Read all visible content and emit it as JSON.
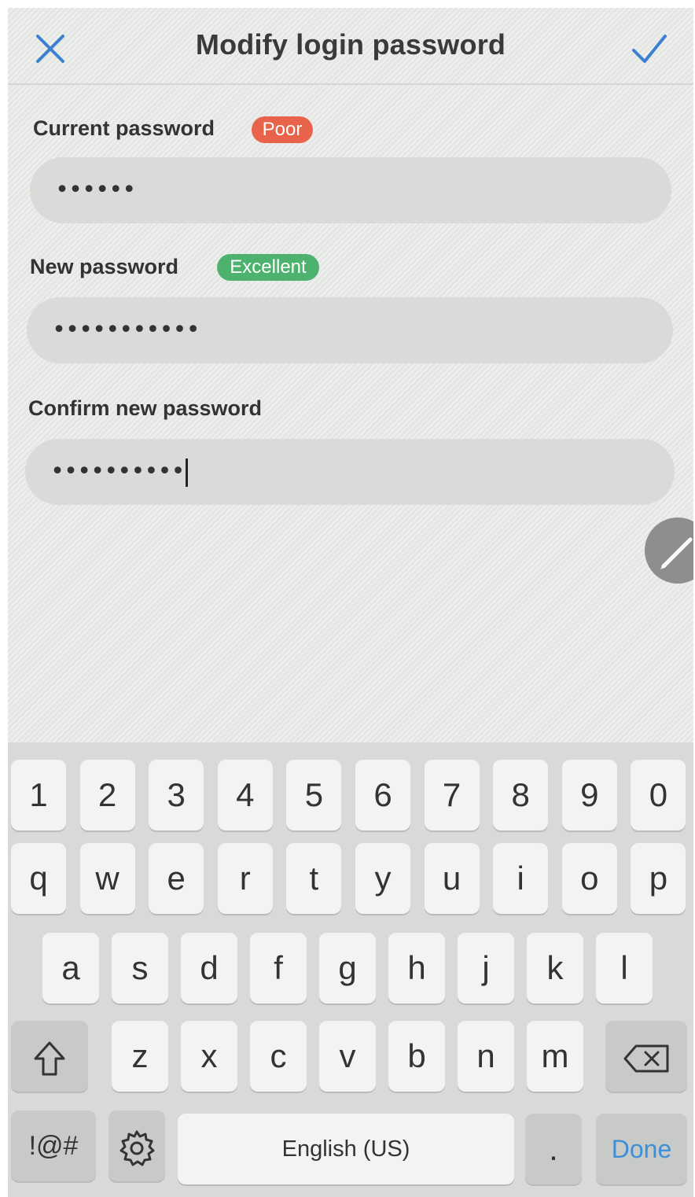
{
  "header": {
    "title": "Modify login password",
    "close_icon": "close-icon",
    "confirm_icon": "checkmark-icon",
    "accent_color": "#3d7fd0"
  },
  "form": {
    "current": {
      "label": "Current password",
      "strength": "Poor",
      "value": "••••••"
    },
    "new": {
      "label": "New password",
      "strength": "Excellent",
      "value": "•••••••••••"
    },
    "confirm": {
      "label": "Confirm new password",
      "value": "••••••••••"
    }
  },
  "colors": {
    "poor": "#e8634a",
    "excellent": "#4cb26d",
    "done": "#3d8fd6"
  },
  "keyboard": {
    "row_numbers": [
      "1",
      "2",
      "3",
      "4",
      "5",
      "6",
      "7",
      "8",
      "9",
      "0"
    ],
    "row1": [
      "q",
      "w",
      "e",
      "r",
      "t",
      "y",
      "u",
      "i",
      "o",
      "p"
    ],
    "row2": [
      "a",
      "s",
      "d",
      "f",
      "g",
      "h",
      "j",
      "k",
      "l"
    ],
    "row3": [
      "z",
      "x",
      "c",
      "v",
      "b",
      "n",
      "m"
    ],
    "symbols_label": "!@#",
    "space_label": "English (US)",
    "period_label": ".",
    "done_label": "Done",
    "shift_icon": "shift-icon",
    "backspace_icon": "backspace-icon",
    "settings_icon": "gear-icon"
  }
}
